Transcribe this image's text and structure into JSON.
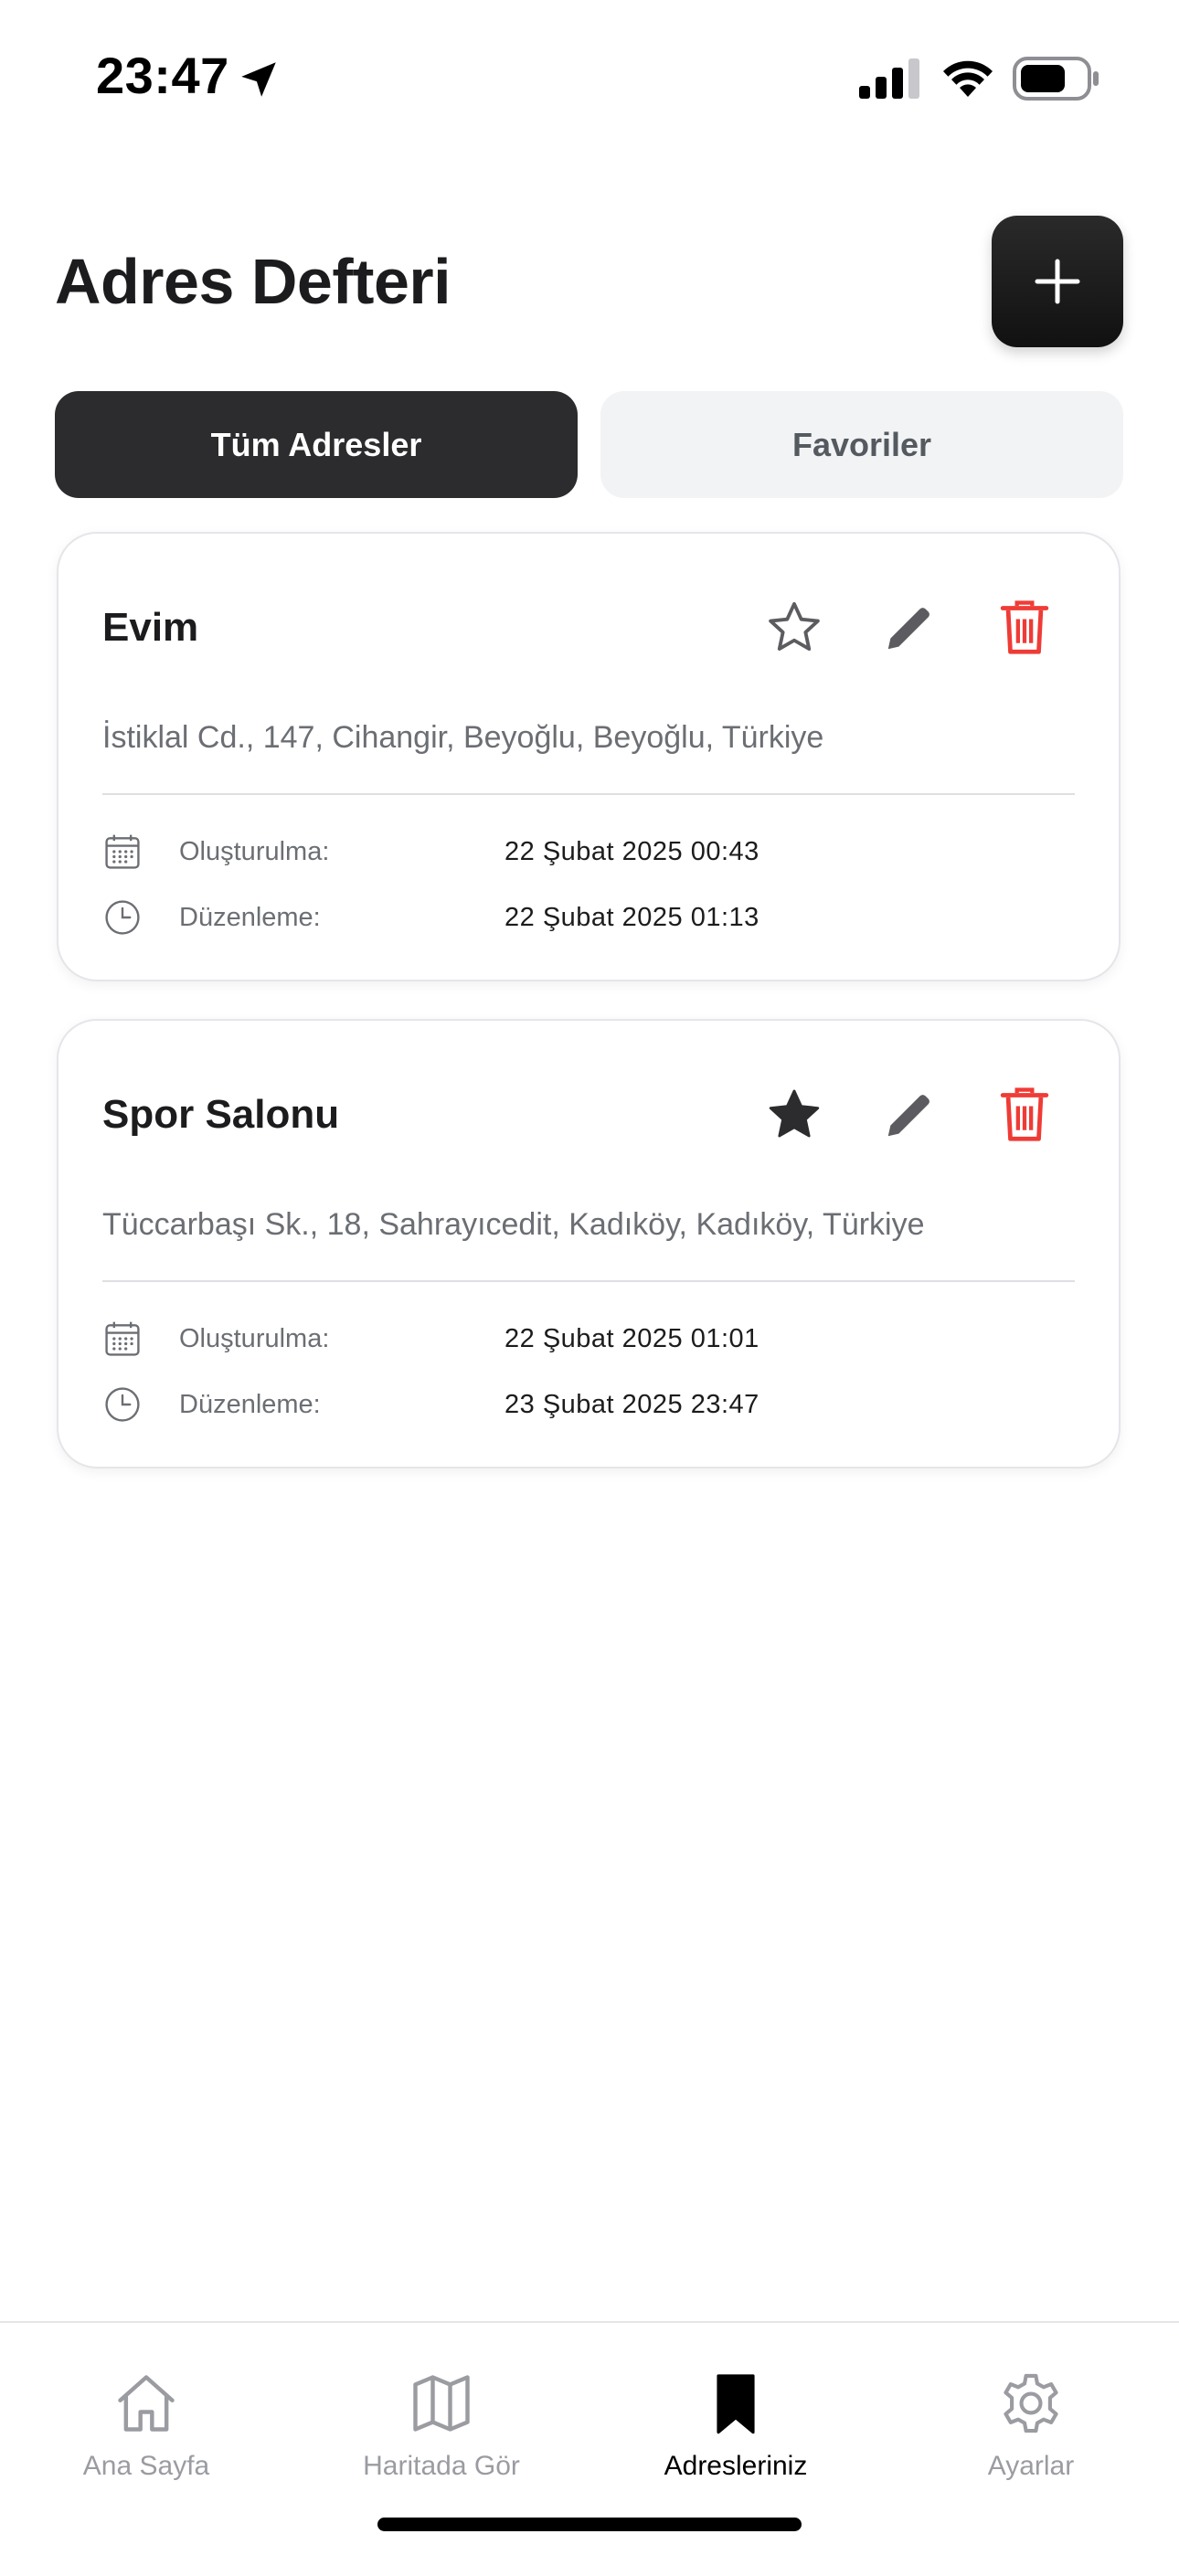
{
  "status_bar": {
    "time": "23:47"
  },
  "header": {
    "title": "Adres Defteri",
    "add_icon": "plus-icon"
  },
  "tabs": [
    {
      "label": "Tüm Adresler",
      "active": true
    },
    {
      "label": "Favoriler",
      "active": false
    }
  ],
  "addresses": [
    {
      "name": "Evim",
      "address": "İstiklal Cd., 147, Cihangir, Beyoğlu, Beyoğlu, Türkiye",
      "favorite": false,
      "created_label": "Oluşturulma:",
      "created": "22 Şubat 2025 00:43",
      "edited_label": "Düzenleme:",
      "edited": "22 Şubat 2025 01:13"
    },
    {
      "name": "Spor Salonu",
      "address": "Tüccarbaşı Sk., 18, Sahrayıcedit, Kadıköy, Kadıköy, Türkiye",
      "favorite": true,
      "created_label": "Oluşturulma:",
      "created": "22 Şubat 2025 01:01",
      "edited_label": "Düzenleme:",
      "edited": "23 Şubat 2025 23:47"
    }
  ],
  "bottom_nav": [
    {
      "label": "Ana Sayfa",
      "icon": "home-icon",
      "active": false
    },
    {
      "label": "Haritada Gör",
      "icon": "map-icon",
      "active": false
    },
    {
      "label": "Adresleriniz",
      "icon": "bookmark-icon",
      "active": true
    },
    {
      "label": "Ayarlar",
      "icon": "gear-icon",
      "active": false
    }
  ],
  "colors": {
    "delete": "#ef3b36",
    "dark": "#2c2c2e",
    "muted": "#6b6e73"
  }
}
